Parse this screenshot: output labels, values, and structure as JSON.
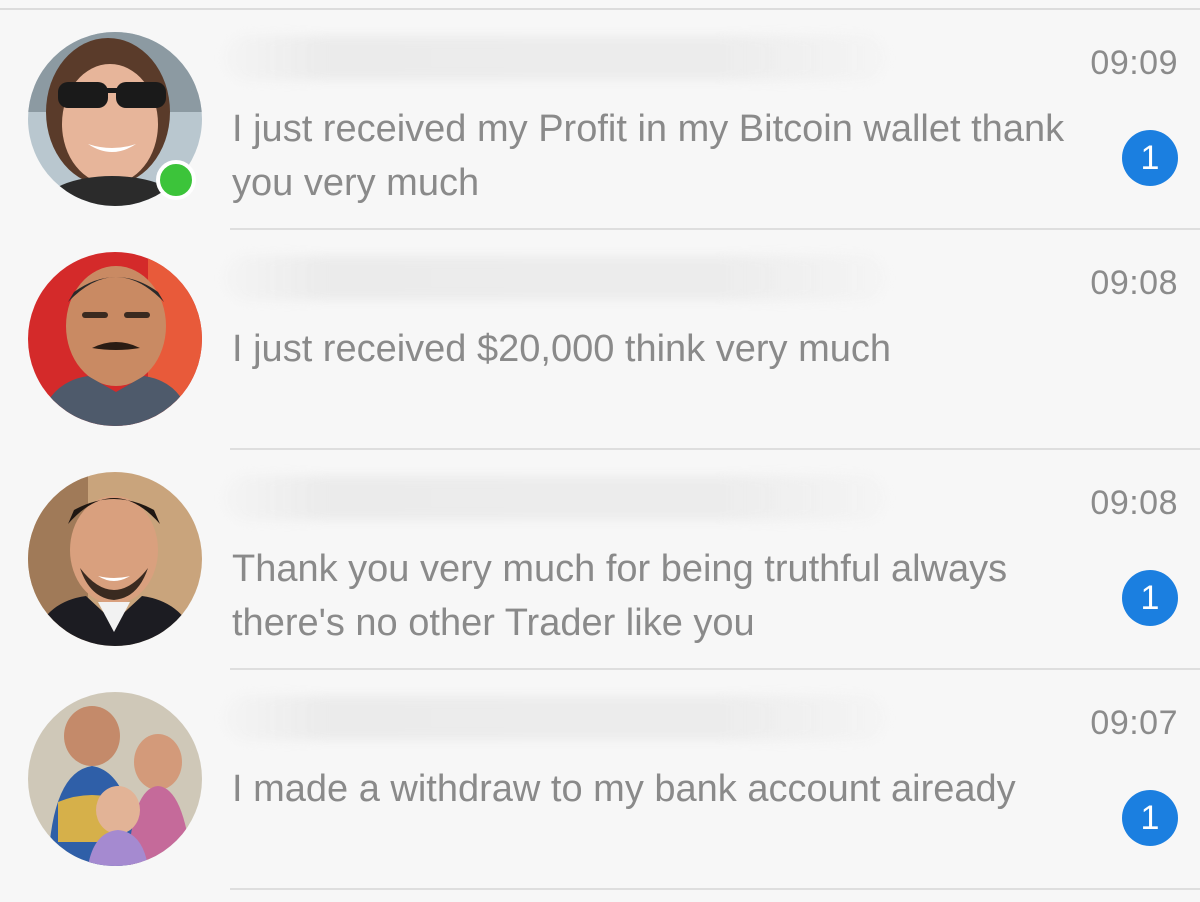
{
  "conversations": [
    {
      "time": "09:09",
      "message": "I just received my Profit in my Bitcoin wallet thank you very much",
      "unread": "1",
      "online": true
    },
    {
      "time": "09:08",
      "message": "I just received $20,000 think very much",
      "unread": null,
      "online": false
    },
    {
      "time": "09:08",
      "message": "Thank you very much for being truthful always there's no other Trader like you",
      "unread": "1",
      "online": false
    },
    {
      "time": "09:07",
      "message": "I made a withdraw to my bank account aiready",
      "unread": "1",
      "online": false
    }
  ],
  "colors": {
    "badge": "#1b7fe0",
    "online": "#3cc43a",
    "text": "#8a8a8a",
    "background": "#f7f7f7"
  }
}
